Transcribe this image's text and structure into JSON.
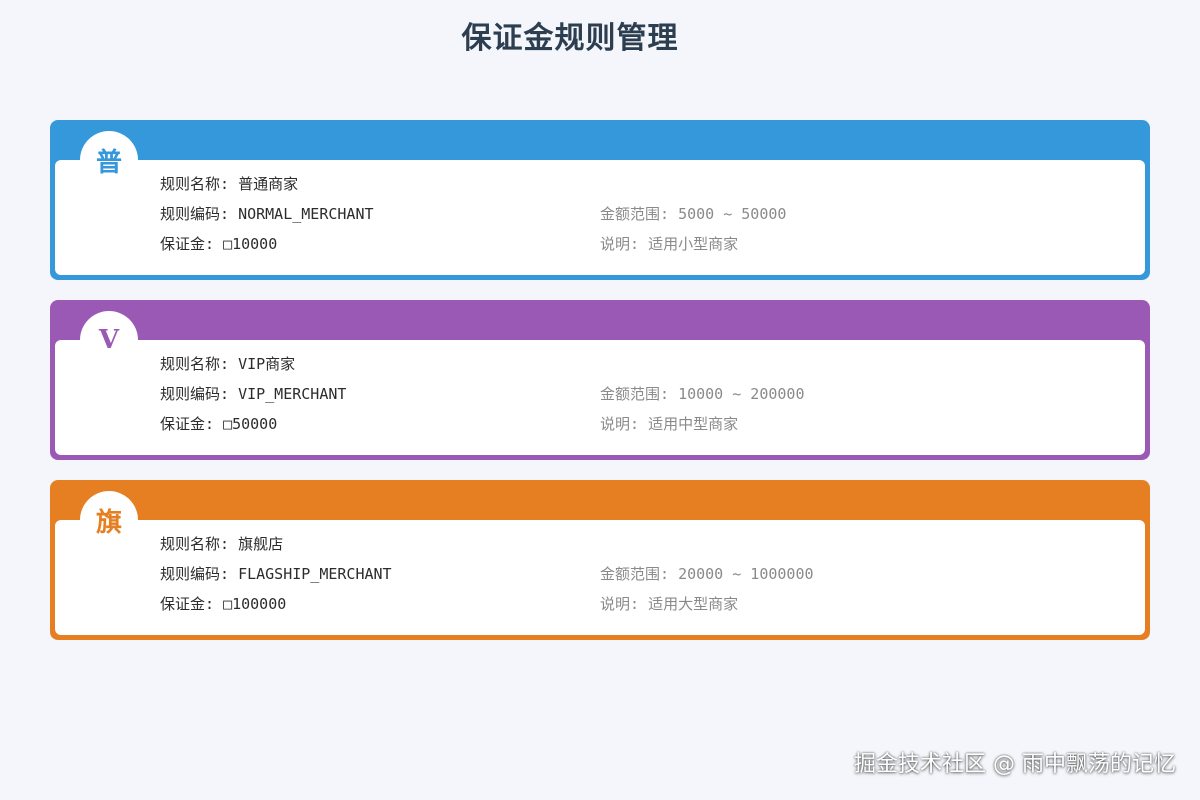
{
  "page": {
    "title": "保证金规则管理"
  },
  "rules": [
    {
      "badge": "普",
      "color": "#3498db",
      "name_label": "规则名称: ",
      "name": "普通商家",
      "code_label": "规则编码: ",
      "code": "NORMAL_MERCHANT",
      "deposit_label": "保证金: ",
      "deposit": "□10000",
      "range_label": "金额范围: ",
      "range": "5000 ~ 50000",
      "desc_label": "说明: ",
      "desc": "适用小型商家"
    },
    {
      "badge": "V",
      "color": "#9b59b6",
      "name_label": "规则名称: ",
      "name": "VIP商家",
      "code_label": "规则编码: ",
      "code": "VIP_MERCHANT",
      "deposit_label": "保证金: ",
      "deposit": "□50000",
      "range_label": "金额范围: ",
      "range": "10000 ~ 200000",
      "desc_label": "说明: ",
      "desc": "适用中型商家"
    },
    {
      "badge": "旗",
      "color": "#e67e22",
      "name_label": "规则名称: ",
      "name": "旗舰店",
      "code_label": "规则编码: ",
      "code": "FLAGSHIP_MERCHANT",
      "deposit_label": "保证金: ",
      "deposit": "□100000",
      "range_label": "金额范围: ",
      "range": "20000 ~ 1000000",
      "desc_label": "说明: ",
      "desc": "适用大型商家"
    }
  ],
  "footer": {
    "watermark": "掘金技术社区 @ 雨中飘荡的记忆"
  }
}
